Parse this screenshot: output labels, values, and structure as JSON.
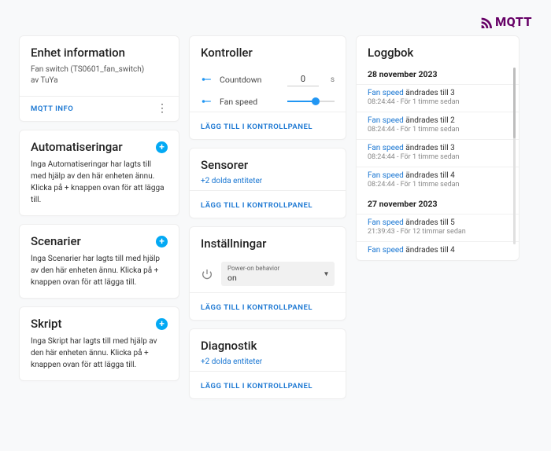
{
  "brand": {
    "name": "MQTT"
  },
  "deviceInfo": {
    "title": "Enhet information",
    "name": "Fan switch (TS0601_fan_switch)",
    "by": "av TuYa",
    "mqttInfoLabel": "MQTT INFO"
  },
  "automations": {
    "title": "Automatiseringar",
    "body": "Inga Automatiseringar har lagts till med hjälp av den här enheten ännu. Klicka på + knappen ovan för att lägga till."
  },
  "scenes": {
    "title": "Scenarier",
    "body": "Inga Scenarier har lagts till med hjälp av den här enheten ännu. Klicka på + knappen ovan för att lägga till."
  },
  "scripts": {
    "title": "Skript",
    "body": "Inga Skript har lagts till med hjälp av den här enheten ännu. Klicka på + knappen ovan för att lägga till."
  },
  "controls": {
    "title": "Kontroller",
    "countdownLabel": "Countdown",
    "countdownValue": "0",
    "countdownUnit": "s",
    "fanSpeedLabel": "Fan speed",
    "addLabel": "LÄGG TILL I KONTROLLPANEL"
  },
  "sensors": {
    "title": "Sensorer",
    "hiddenLabel": "+2 dolda entiteter",
    "addLabel": "LÄGG TILL I KONTROLLPANEL"
  },
  "settings": {
    "title": "Inställningar",
    "selectLabel": "Power-on behavior",
    "selectValue": "on",
    "addLabel": "LÄGG TILL I KONTROLLPANEL"
  },
  "diagnostics": {
    "title": "Diagnostik",
    "hiddenLabel": "+2 dolda entiteter",
    "addLabel": "LÄGG TILL I KONTROLLPANEL"
  },
  "logbook": {
    "title": "Loggbok",
    "groups": [
      {
        "date": "28 november 2023",
        "items": [
          {
            "entity": "Fan speed",
            "rest": " ändrades till 3",
            "time": "08:24:44",
            "rel": "För 1 timme sedan"
          },
          {
            "entity": "Fan speed",
            "rest": " ändrades till 2",
            "time": "08:24:44",
            "rel": "För 1 timme sedan"
          },
          {
            "entity": "Fan speed",
            "rest": " ändrades till 3",
            "time": "08:24:44",
            "rel": "För 1 timme sedan"
          },
          {
            "entity": "Fan speed",
            "rest": " ändrades till 4",
            "time": "08:24:44",
            "rel": "För 1 timme sedan"
          }
        ]
      },
      {
        "date": "27 november 2023",
        "items": [
          {
            "entity": "Fan speed",
            "rest": " ändrades till 5",
            "time": "21:39:43",
            "rel": "För 12 timmar sedan"
          },
          {
            "entity": "Fan speed",
            "rest": " ändrades till 4",
            "time": "",
            "rel": ""
          }
        ]
      }
    ]
  }
}
